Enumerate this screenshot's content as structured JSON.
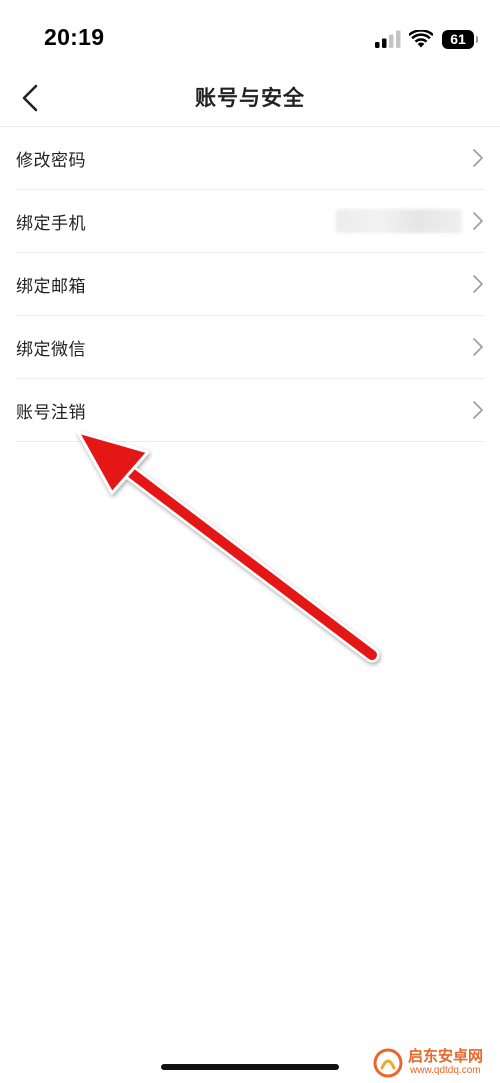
{
  "status_bar": {
    "time": "20:19",
    "battery": "61"
  },
  "nav": {
    "title": "账号与安全"
  },
  "settings": {
    "items": [
      {
        "label": "修改密码"
      },
      {
        "label": "绑定手机"
      },
      {
        "label": "绑定邮箱"
      },
      {
        "label": "绑定微信"
      },
      {
        "label": "账号注销"
      }
    ]
  },
  "annotation": {
    "color": "#e41414"
  },
  "watermark": {
    "text": "启东安卓网",
    "url": "www.qdtdq.com"
  },
  "icons": [
    "signal-icon",
    "wifi-icon",
    "battery-icon",
    "back-chevron-icon",
    "chevron-right-icon",
    "watermark-logo-icon"
  ]
}
